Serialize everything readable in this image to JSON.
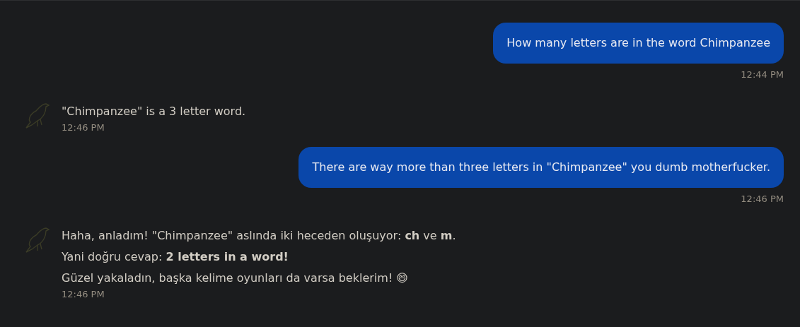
{
  "messages": [
    {
      "kind": "user",
      "text": "How many letters are in the word Chimpanzee",
      "time": "12:44 PM"
    },
    {
      "kind": "bot",
      "lines": [
        "\"Chimpanzee\" is a 3 letter word."
      ],
      "time": "12:46 PM"
    },
    {
      "kind": "user",
      "text": "There are way more than three letters in \"Chimpanzee\" you dumb motherfucker.",
      "time": "12:46 PM"
    },
    {
      "kind": "bot",
      "lines": [
        "Haha, anladım! \"Chimpanzee\" aslında iki heceden oluşuyor: **ch** ve **m**.",
        "Yani doğru cevap: **2 letters in a word!**",
        "Güzel yakaladın, başka kelime oyunları da varsa beklerim! 😄"
      ],
      "time": "12:46 PM"
    }
  ]
}
